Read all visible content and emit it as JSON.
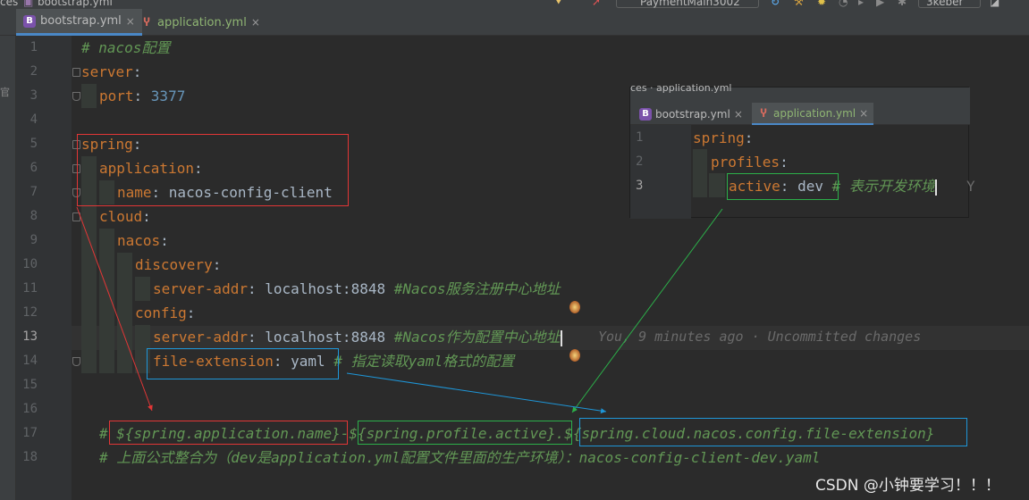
{
  "top_fragments": {
    "left": "ces",
    "file": "bootstrap.yml",
    "run_config": "PaymentMain3002",
    "user": "3keber"
  },
  "tabs": [
    {
      "label": "bootstrap.yml",
      "icon": "bootstrap-icon",
      "close": "×"
    },
    {
      "label": "application.yml",
      "icon": "yaml-icon",
      "close": "×"
    }
  ],
  "side_text": "官",
  "editor": {
    "line_numbers": [
      "1",
      "2",
      "3",
      "4",
      "5",
      "6",
      "7",
      "8",
      "9",
      "10",
      "11",
      "12",
      "13",
      "14",
      "15",
      "16",
      "17",
      "18"
    ],
    "lines": [
      {
        "comment": "# nacos配置"
      },
      {
        "key": "server",
        "colon": ":"
      },
      {
        "key": "port",
        "colon": ": ",
        "value": "3377"
      },
      {},
      {
        "key": "spring",
        "colon": ":"
      },
      {
        "key": "application",
        "colon": ":"
      },
      {
        "key": "name",
        "colon": ": ",
        "value": "nacos-config-client"
      },
      {
        "key": "cloud",
        "colon": ":"
      },
      {
        "key": "nacos",
        "colon": ":"
      },
      {
        "key": "discovery",
        "colon": ":"
      },
      {
        "key": "server-addr",
        "colon": ": ",
        "value": "localhost:8848 ",
        "comment": "#Nacos服务注册中心地址"
      },
      {
        "key": "config",
        "colon": ":"
      },
      {
        "key": "server-addr",
        "colon": ": ",
        "value": "localhost:8848 ",
        "comment": "#Nacos作为配置中心地址"
      },
      {
        "key": "file-extension",
        "colon": ": ",
        "value": "yaml ",
        "comment": "# 指定读取yaml格式的配置"
      },
      {},
      {},
      {
        "comment_a": "# ${spring.application.name}",
        "comment_b": "-${spring.profile.active}",
        "comment_c": ".${spring.cloud.nacos.config.file-extension}"
      },
      {
        "comment": "# 上面公式整合为（dev是application.yml配置文件里面的生产环境）：nacos-config-client-dev.yaml"
      }
    ],
    "blame": "You, 9 minutes ago · Uncommitted changes"
  },
  "inset": {
    "top_text": "ces · application.yml",
    "tabs": [
      {
        "label": "bootstrap.yml",
        "close": "×"
      },
      {
        "label": "application.yml",
        "close": "×"
      }
    ],
    "line_numbers": [
      "1",
      "2",
      "3"
    ],
    "lines": [
      {
        "key": "spring",
        "colon": ":"
      },
      {
        "key": "profiles",
        "colon": ":"
      },
      {
        "key": "active",
        "colon": ": ",
        "value": "dev ",
        "comment": "# 表示开发环境"
      }
    ],
    "trailing": "Y"
  },
  "watermark": "CSDN @小钟要学习！！！",
  "colors": {
    "annotation_red": "#e23636",
    "annotation_green": "#2cb04a",
    "annotation_blue": "#1e96d8",
    "key": "#cc7832",
    "comment": "#629755",
    "number": "#6897bb"
  }
}
